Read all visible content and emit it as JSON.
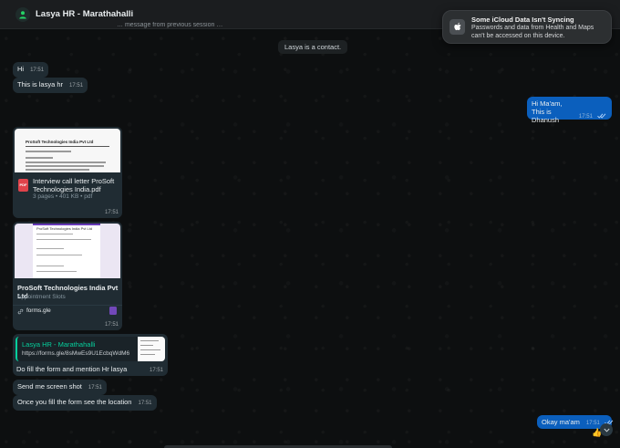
{
  "header": {
    "chat_title": "Lasya HR - Marathahalli",
    "preview_line": "… message from previous session …"
  },
  "notification": {
    "title": "Some iCloud Data Isn't Syncing",
    "body": "Passwords and data from Health and Maps can't be accessed on this device.",
    "icon": "apple-icon"
  },
  "system_message": "Lasya is a contact.",
  "messages": {
    "hi": {
      "text": "Hi",
      "time": "17:51"
    },
    "lasya": {
      "text": "This is lasya hr",
      "time": "17:51"
    },
    "maam": {
      "line1": "Hi Ma'am,",
      "line2": "This is Dhanush",
      "time": "17:51"
    },
    "pdf": {
      "filename": "Interview call letter ProSoft Technologies India.pdf",
      "meta": "3 pages • 401 KB • pdf",
      "time": "17:51",
      "preview_heading": "ProSoft Technologies India Pvt Ltd",
      "type_label": "PDF"
    },
    "form_link": {
      "title": "ProSoft Technologies India Pvt Ltd",
      "subtitle": "Appointment Slots",
      "domain": "forms.gle",
      "time": "17:51",
      "preview_title": "ProSoft Technologies India Pvt Ltd"
    },
    "quoted": {
      "author": "Lasya HR - Marathahalli",
      "url": "https://forms.gle/8sMwEs9U1EcbqWdM6",
      "text": "Do fill the form and mention Hr lasya",
      "time": "17:51"
    },
    "screenshot": {
      "text": "Send me screen shot",
      "time": "17:51"
    },
    "location": {
      "text": "Once you fill the form see the location",
      "time": "17:51"
    },
    "okay": {
      "text": "Okay ma'am",
      "time": "17:51"
    }
  },
  "reaction_emoji": "👍",
  "colors": {
    "incoming_bubble": "#202c33",
    "outgoing_bubble": "#0b5fbd",
    "accent": "#06cf9c"
  }
}
